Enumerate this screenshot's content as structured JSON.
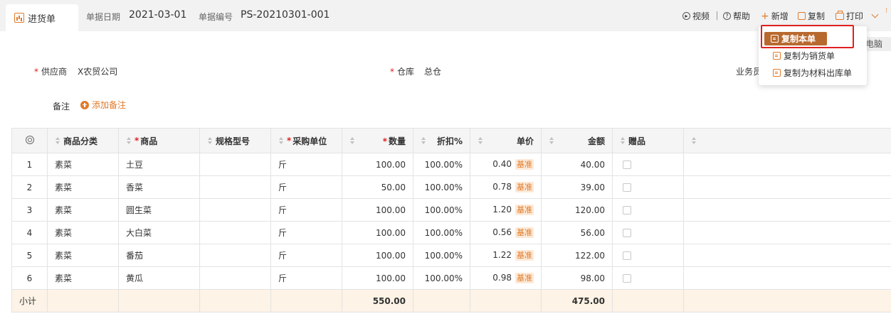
{
  "header": {
    "tab_label": "进货单",
    "date_label": "单据日期",
    "date_value": "2021-03-01",
    "number_label": "单据编号",
    "number_value": "PS-20210301-001"
  },
  "toolbar": {
    "video_label": "视频",
    "help_label": "帮助",
    "new_label": "新增",
    "copy_label": "复制",
    "print_label": "打印"
  },
  "dropdown": {
    "items": [
      "复制本单",
      "复制为销货单",
      "复制为材料出库单"
    ]
  },
  "pc_tag": "电脑",
  "form": {
    "supplier_label": "供应商",
    "supplier_value": "X农贸公司",
    "warehouse_label": "仓库",
    "warehouse_value": "总仓",
    "salesperson_label": "业务员",
    "note_label": "备注",
    "add_note_label": "添加备注"
  },
  "table": {
    "columns": [
      "商品分类",
      "商品",
      "规格型号",
      "采购单位",
      "数量",
      "折扣%",
      "单价",
      "金额",
      "赠品"
    ],
    "price_badge": "基准",
    "rows": [
      {
        "no": "1",
        "category": "素菜",
        "product": "土豆",
        "spec": "",
        "unit": "斤",
        "qty": "100.00",
        "discount": "100.00%",
        "price": "0.40",
        "amount": "40.00"
      },
      {
        "no": "2",
        "category": "素菜",
        "product": "香菜",
        "spec": "",
        "unit": "斤",
        "qty": "50.00",
        "discount": "100.00%",
        "price": "0.78",
        "amount": "39.00"
      },
      {
        "no": "3",
        "category": "素菜",
        "product": "圆生菜",
        "spec": "",
        "unit": "斤",
        "qty": "100.00",
        "discount": "100.00%",
        "price": "1.20",
        "amount": "120.00"
      },
      {
        "no": "4",
        "category": "素菜",
        "product": "大白菜",
        "spec": "",
        "unit": "斤",
        "qty": "100.00",
        "discount": "100.00%",
        "price": "0.56",
        "amount": "56.00"
      },
      {
        "no": "5",
        "category": "素菜",
        "product": "番茄",
        "spec": "",
        "unit": "斤",
        "qty": "100.00",
        "discount": "100.00%",
        "price": "1.22",
        "amount": "122.00"
      },
      {
        "no": "6",
        "category": "素菜",
        "product": "黄瓜",
        "spec": "",
        "unit": "斤",
        "qty": "100.00",
        "discount": "100.00%",
        "price": "0.98",
        "amount": "98.00"
      }
    ],
    "subtotal": {
      "label": "小计",
      "qty": "550.00",
      "amount": "475.00"
    }
  },
  "colors": {
    "accent": "#e07b2c",
    "selected_bg": "#b8692e",
    "highlight": "#e02020",
    "subtotal_bg": "#fdf3e6"
  }
}
